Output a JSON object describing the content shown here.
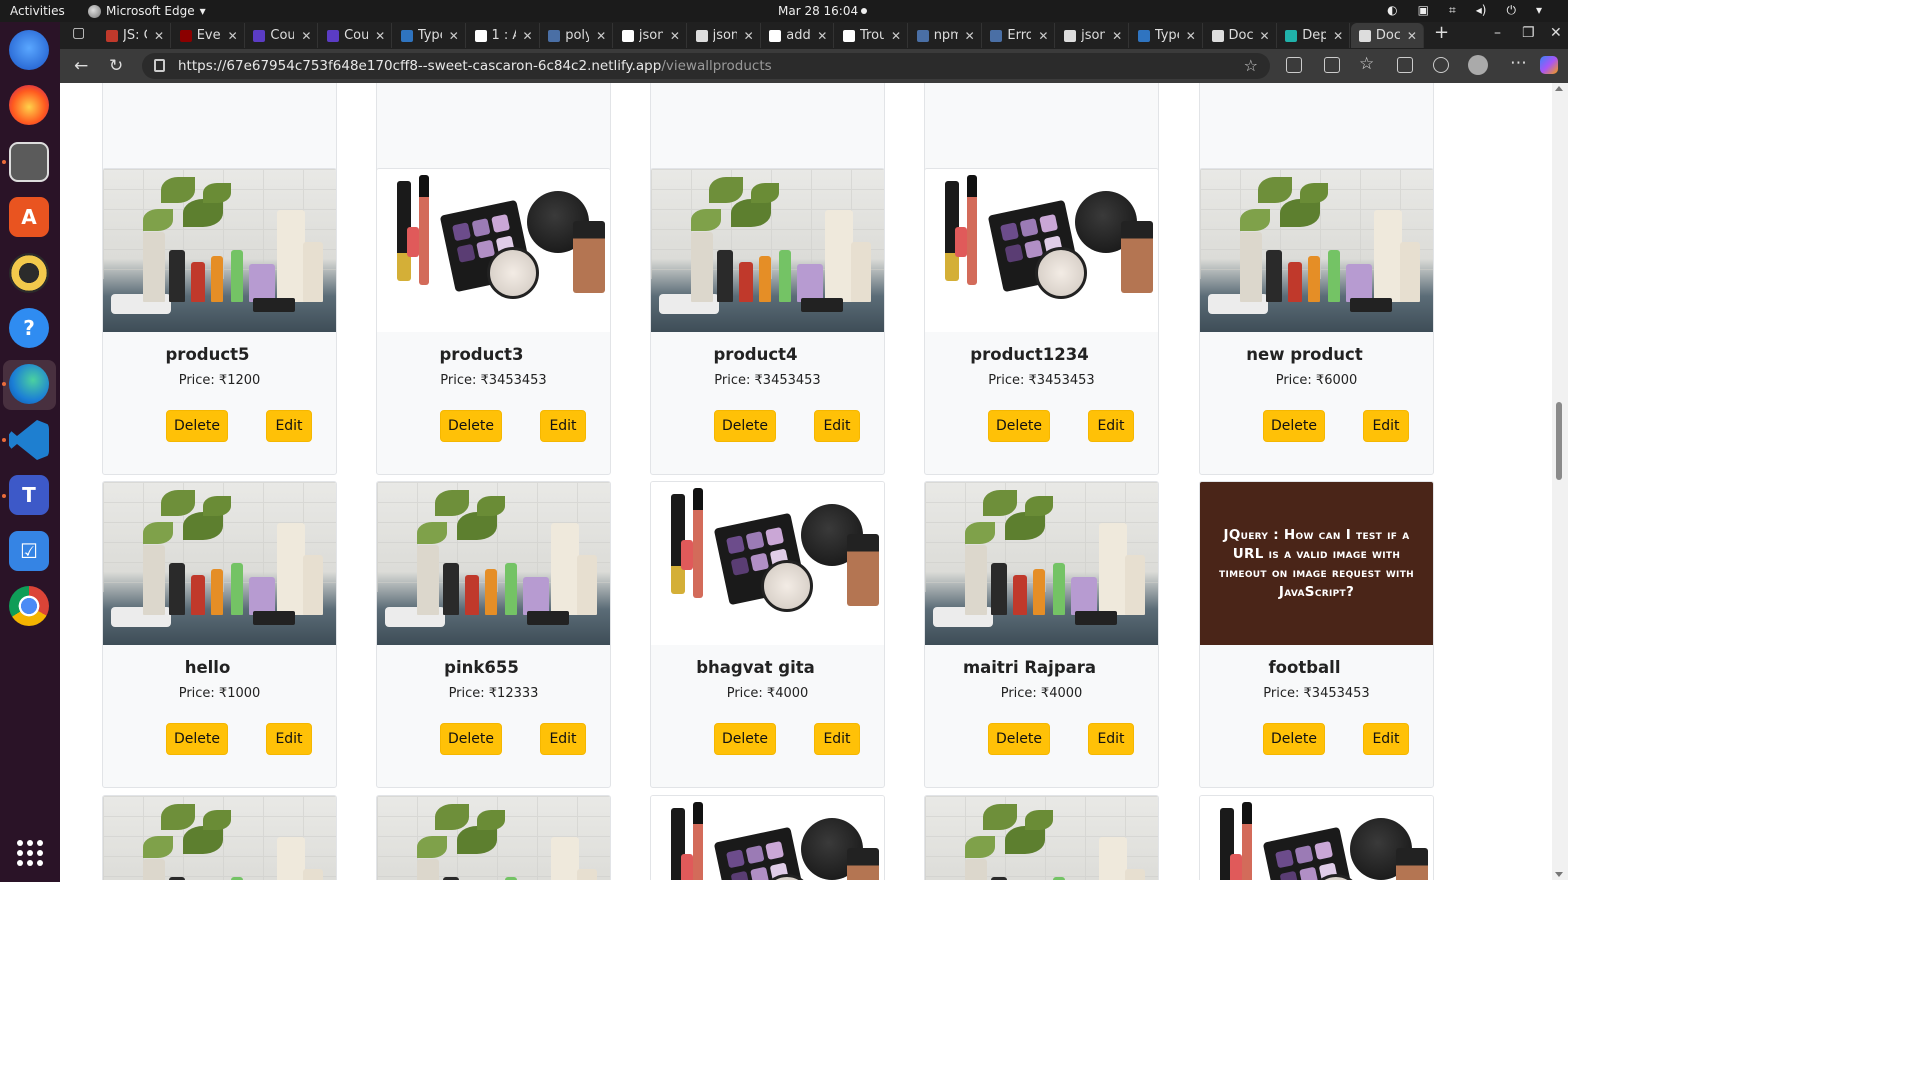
{
  "system": {
    "activities": "Activities",
    "app_name": "Microsoft Edge",
    "clock": "Mar 28  16:04"
  },
  "browser": {
    "tabs": [
      {
        "label": "JS: C",
        "fav": "#c0392b"
      },
      {
        "label": "Ever",
        "fav": "#8b0000"
      },
      {
        "label": "Cou",
        "fav": "#5b3cc4"
      },
      {
        "label": "Cou",
        "fav": "#5b3cc4"
      },
      {
        "label": "Type",
        "fav": "#2f74c0"
      },
      {
        "label": "1 : A",
        "fav": "#ffffff"
      },
      {
        "label": "poly",
        "fav": "#4a6fa5"
      },
      {
        "label": "json",
        "fav": "#ffffff"
      },
      {
        "label": "json",
        "fav": "#dddddd"
      },
      {
        "label": "add",
        "fav": "#ffffff"
      },
      {
        "label": "Trou",
        "fav": "#ffffff"
      },
      {
        "label": "npm",
        "fav": "#4a6fa5"
      },
      {
        "label": "Erro",
        "fav": "#4a6fa5"
      },
      {
        "label": "json",
        "fav": "#dddddd"
      },
      {
        "label": "Type",
        "fav": "#2f74c0"
      },
      {
        "label": "Doc",
        "fav": "#dddddd"
      },
      {
        "label": "Dep",
        "fav": "#20b2aa"
      },
      {
        "label": "Doc",
        "fav": "#dddddd"
      }
    ],
    "active_tab_index": 17,
    "url_host": "https://67e67954c753f648e170cff8--sweet-cascaron-6c84c2.netlify.app",
    "url_path": "/viewallproducts"
  },
  "actions": {
    "delete_label": "Delete",
    "edit_label": "Edit"
  },
  "products": [
    {
      "name": "",
      "price": "",
      "image": "none"
    },
    {
      "name": "",
      "price": "",
      "image": "none"
    },
    {
      "name": "",
      "price": "",
      "image": "none"
    },
    {
      "name": "",
      "price": "",
      "image": "none"
    },
    {
      "name": "",
      "price": "",
      "image": "none"
    },
    {
      "name": "product5",
      "price": "Price: ₹1200",
      "image": "skincare-photo"
    },
    {
      "name": "product3",
      "price": "Price: ₹3453453",
      "image": "makeup-photo"
    },
    {
      "name": "product4",
      "price": "Price: ₹3453453",
      "image": "skincare-photo"
    },
    {
      "name": "product1234",
      "price": "Price: ₹3453453",
      "image": "makeup-photo"
    },
    {
      "name": "new product",
      "price": "Price: ₹6000",
      "image": "skincare-photo"
    },
    {
      "name": "hello",
      "price": "Price: ₹1000",
      "image": "skincare-photo"
    },
    {
      "name": "pink655",
      "price": "Price: ₹12333",
      "image": "skincare-photo"
    },
    {
      "name": "bhagvat gita",
      "price": "Price: ₹4000",
      "image": "makeup-photo"
    },
    {
      "name": "maitri Rajpara",
      "price": "Price: ₹4000",
      "image": "skincare-photo"
    },
    {
      "name": "football",
      "price": "Price: ₹3453453",
      "image": "text-banner",
      "banner_text": "JQuery : How can I test if a URL is a valid image with timeout on image request with JavaScript?"
    },
    {
      "name": "",
      "price": "",
      "image": "skincare-photo"
    },
    {
      "name": "",
      "price": "",
      "image": "skincare-photo"
    },
    {
      "name": "",
      "price": "",
      "image": "makeup-photo"
    },
    {
      "name": "",
      "price": "",
      "image": "skincare-photo"
    },
    {
      "name": "",
      "price": "",
      "image": "makeup-photo"
    }
  ]
}
